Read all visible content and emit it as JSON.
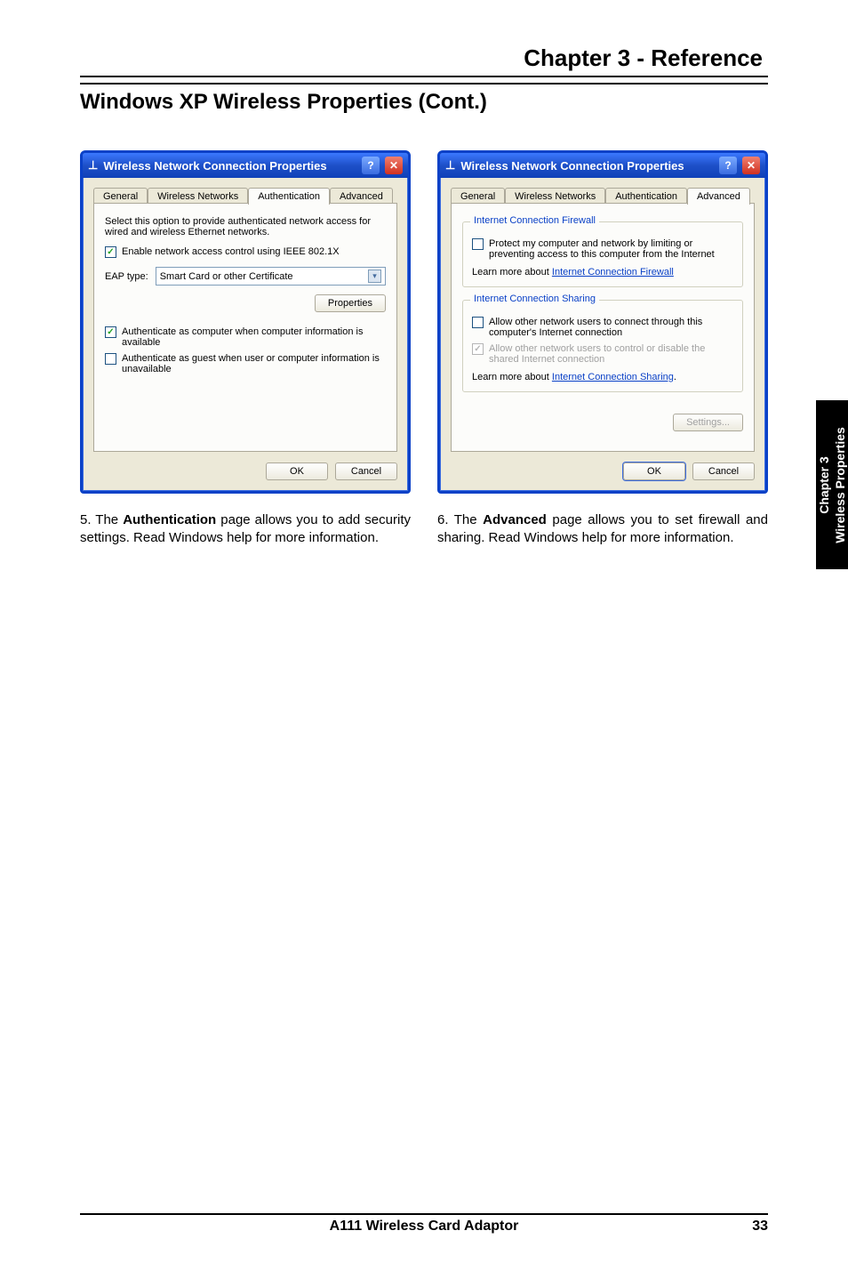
{
  "header": {
    "chapter_title": "Chapter 3 - Reference",
    "section_title": "Windows XP Wireless Properties (Cont.)"
  },
  "left_dialog": {
    "title": "Wireless Network Connection Properties",
    "tabs": {
      "general": "General",
      "wireless": "Wireless Networks",
      "auth": "Authentication",
      "advanced": "Advanced"
    },
    "intro": "Select this option to provide authenticated network access for wired and wireless Ethernet networks.",
    "enable_8021x": "Enable network access control using IEEE 802.1X",
    "eap_label": "EAP type:",
    "eap_value": "Smart Card or other Certificate",
    "properties_btn": "Properties",
    "auth_as_computer": "Authenticate as computer when computer information is available",
    "auth_as_guest": "Authenticate as guest when user or computer information is unavailable",
    "ok": "OK",
    "cancel": "Cancel"
  },
  "right_dialog": {
    "title": "Wireless Network Connection Properties",
    "tabs": {
      "general": "General",
      "wireless": "Wireless Networks",
      "auth": "Authentication",
      "advanced": "Advanced"
    },
    "group_firewall": "Internet Connection Firewall",
    "protect_cb": "Protect my computer and network by limiting or preventing access to this computer from the Internet",
    "learn_firewall_pre": "Learn more about ",
    "learn_firewall_link": "Internet Connection Firewall",
    "group_sharing": "Internet Connection Sharing",
    "allow_connect": "Allow other network users to connect through this computer's Internet connection",
    "allow_control": "Allow other network users to control or disable the shared Internet connection",
    "learn_sharing_pre": "Learn more about ",
    "learn_sharing_link": "Internet Connection Sharing",
    "settings_btn": "Settings...",
    "ok": "OK",
    "cancel": "Cancel"
  },
  "steps": {
    "s5_num": "5.",
    "s5_pre": " The ",
    "s5_bold": "Authentication",
    "s5_post": " page allows you to add security settings. Read Windows help for more information.",
    "s6_num": "6.",
    "s6_pre": " The ",
    "s6_bold": "Advanced",
    "s6_post": " page allows you to set firewall and sharing. Read Windows help for more information."
  },
  "side_tab": {
    "line1": "Chapter 3",
    "line2": "Wireless Properties"
  },
  "footer": {
    "product": "A111 Wireless Card Adaptor",
    "page": "33"
  }
}
